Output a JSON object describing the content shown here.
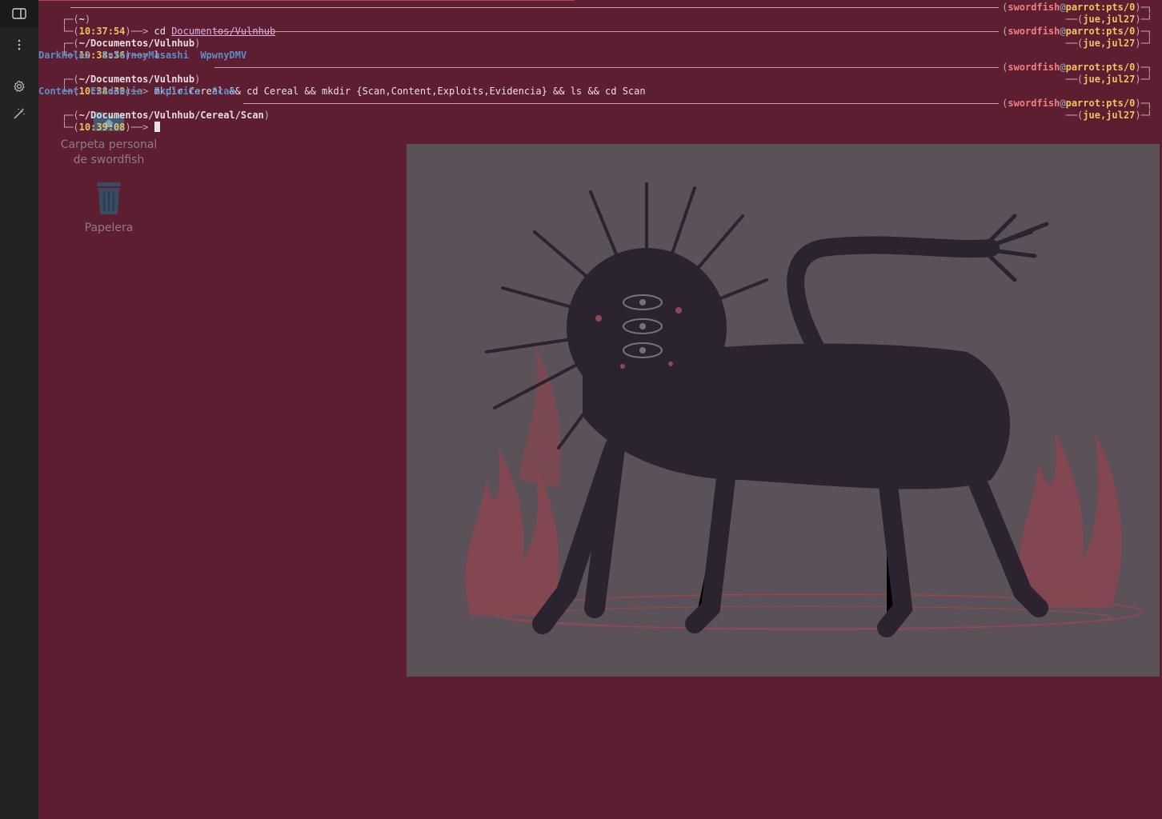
{
  "desktop": {
    "icons": [
      {
        "label": "Carpeta personal de swordfish",
        "icon": "home-folder-icon"
      },
      {
        "label": "Papelera",
        "icon": "trash-icon"
      }
    ]
  },
  "sidebar": {
    "buttons": [
      "panel-toggle-icon",
      "kebab-menu-icon",
      "gear-icon",
      "magic-wand-icon"
    ]
  },
  "terminal": {
    "blocks": [
      {
        "cwd": "~",
        "time": "10:37:54",
        "cmd_plain": "cd ",
        "cmd_link": "Documentos/Vulnhub",
        "user": "swordfish",
        "host": "parrot:pts/0",
        "date": "jue,jul27"
      },
      {
        "cwd": "~/Documentos/Vulnhub",
        "time": "10:38:36",
        "cmd_plain": "ls",
        "user": "swordfish",
        "host": "parrot:pts/0",
        "date": "jue,jul27",
        "output": [
          "DarkHole2",
          "InfernoyMasashi",
          "WpwnyDMV"
        ]
      },
      {
        "cwd": "~/Documentos/Vulnhub",
        "time": "10:38:39",
        "cmd_plain": "mkdir Cereal && cd Cereal && mkdir {Scan,Content,Exploits,Evidencia} && ls && cd Scan",
        "user": "swordfish",
        "host": "parrot:pts/0",
        "date": "jue,jul27",
        "output": [
          "Content",
          "Evidencia",
          "Exploits",
          "Scan"
        ]
      },
      {
        "cwd": "~/Documentos/Vulnhub/Cereal/Scan",
        "time": "10:39:08",
        "cmd_plain": "",
        "user": "swordfish",
        "host": "parrot:pts/0",
        "date": "jue,jul27"
      }
    ]
  },
  "colors": {
    "background": "#5c1e30",
    "sidebar": "#232323",
    "time": "#f0c060",
    "directory": "#5b8ec6",
    "user": "#f08080"
  }
}
